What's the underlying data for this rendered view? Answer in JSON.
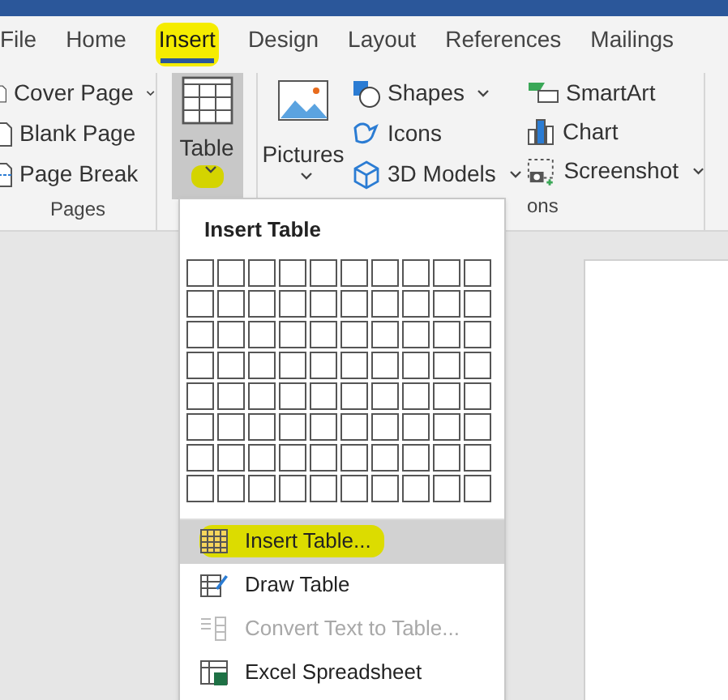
{
  "tabs": [
    {
      "label": "File",
      "selected": false,
      "highlighted": false
    },
    {
      "label": "Home",
      "selected": false,
      "highlighted": false
    },
    {
      "label": "Insert",
      "selected": true,
      "highlighted": true
    },
    {
      "label": "Design",
      "selected": false,
      "highlighted": false
    },
    {
      "label": "Layout",
      "selected": false,
      "highlighted": false
    },
    {
      "label": "References",
      "selected": false,
      "highlighted": false
    },
    {
      "label": "Mailings",
      "selected": false,
      "highlighted": false
    }
  ],
  "pages_group": {
    "items": [
      {
        "label": "Cover Page",
        "dropdown": true
      },
      {
        "label": "Blank Page",
        "dropdown": false
      },
      {
        "label": "Page Break",
        "dropdown": false
      }
    ],
    "label": "Pages"
  },
  "table_button": {
    "label": "Table",
    "pressed": true,
    "caret_highlighted": true
  },
  "pictures_button": {
    "label": "Pictures"
  },
  "illustrations": {
    "column_1": [
      {
        "label": "Shapes",
        "dropdown": true
      },
      {
        "label": "Icons",
        "dropdown": false
      },
      {
        "label": "3D Models",
        "dropdown": true
      }
    ],
    "column_2": [
      {
        "label": "SmartArt",
        "dropdown": false
      },
      {
        "label": "Chart",
        "dropdown": false
      },
      {
        "label": "Screenshot",
        "dropdown": true
      }
    ],
    "label": "ons"
  },
  "table_menu": {
    "title": "Insert Table",
    "items": [
      {
        "label": "Insert Table...",
        "kind": "insert",
        "selected": true,
        "highlighted": true,
        "disabled": false
      },
      {
        "label": "Draw Table",
        "kind": "draw",
        "selected": false,
        "highlighted": false,
        "disabled": false
      },
      {
        "label": "Convert Text to Table...",
        "kind": "convert",
        "selected": false,
        "highlighted": false,
        "disabled": true
      },
      {
        "label": "Excel Spreadsheet",
        "kind": "excel",
        "selected": false,
        "highlighted": false,
        "disabled": false
      }
    ]
  }
}
